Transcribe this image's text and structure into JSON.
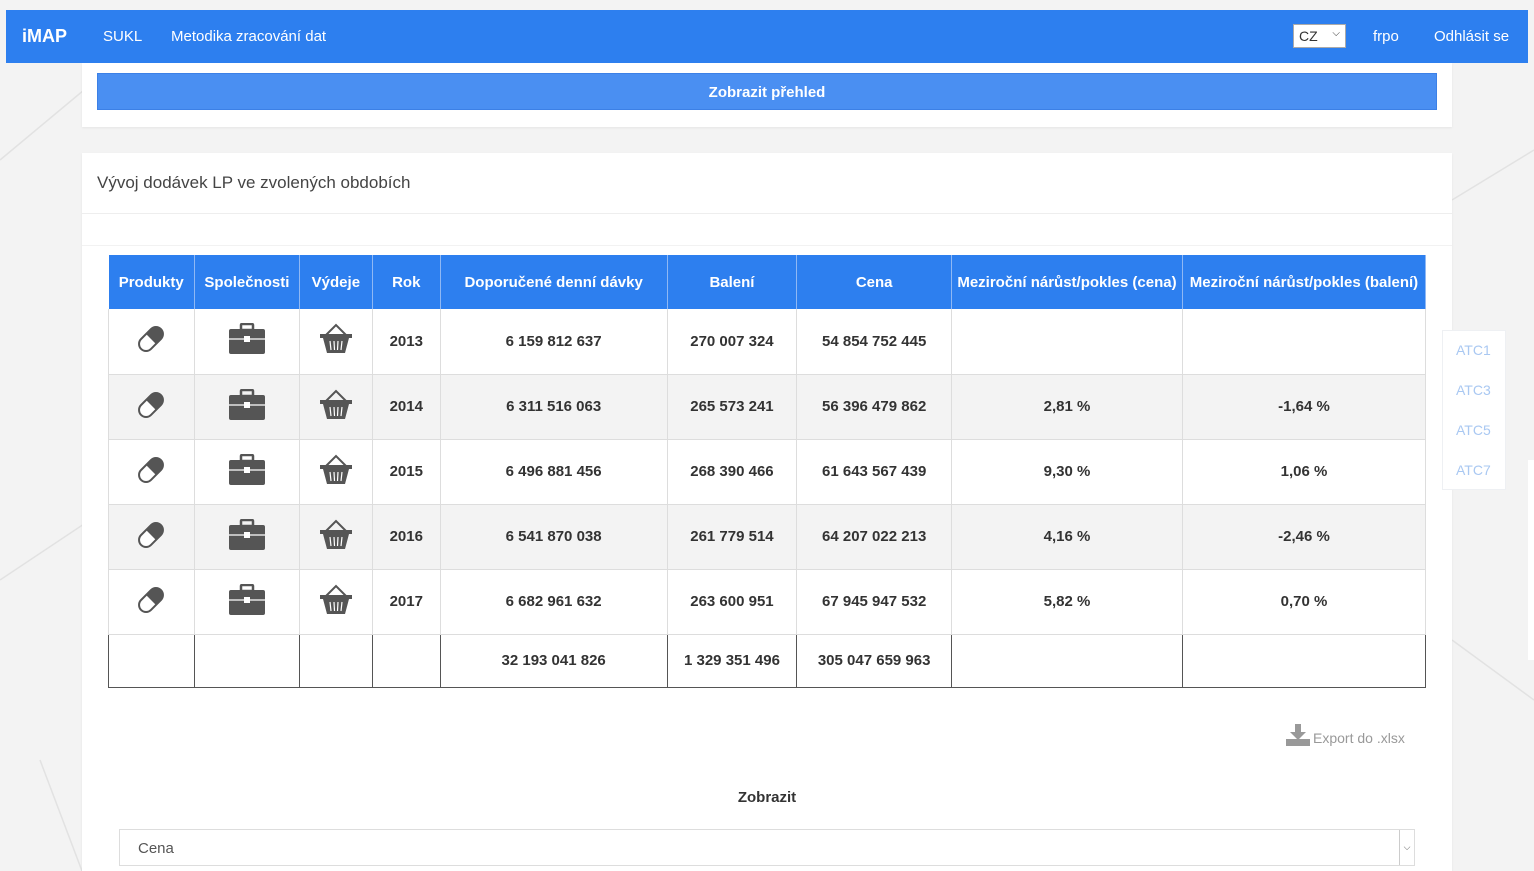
{
  "navbar": {
    "brand": "iMAP",
    "links": [
      "SUKL",
      "Metodika zracování dat"
    ],
    "language": "CZ",
    "user": "frpo",
    "logout": "Odhlásit se"
  },
  "top_card": {
    "button_label": "Zobrazit přehled"
  },
  "main": {
    "title": "Vývoj dodávek LP ve zvolených obdobích",
    "table": {
      "headers": [
        "Produkty",
        "Společnosti",
        "Výdeje",
        "Rok",
        "Doporučené denní dávky",
        "Balení",
        "Cena",
        "Meziroční nárůst/pokles (cena)",
        "Meziroční nárůst/pokles (balení)"
      ],
      "rows": [
        {
          "year": "2013",
          "ddd": "6 159 812 637",
          "baleni": "270 007 324",
          "cena": "54 854 752 445",
          "yoy_cena": "",
          "yoy_baleni": ""
        },
        {
          "year": "2014",
          "ddd": "6 311 516 063",
          "baleni": "265 573 241",
          "cena": "56 396 479 862",
          "yoy_cena": "2,81 %",
          "yoy_baleni": "-1,64 %"
        },
        {
          "year": "2015",
          "ddd": "6 496 881 456",
          "baleni": "268 390 466",
          "cena": "61 643 567 439",
          "yoy_cena": "9,30 %",
          "yoy_baleni": "1,06 %"
        },
        {
          "year": "2016",
          "ddd": "6 541 870 038",
          "baleni": "261 779 514",
          "cena": "64 207 022 213",
          "yoy_cena": "4,16 %",
          "yoy_baleni": "-2,46 %"
        },
        {
          "year": "2017",
          "ddd": "6 682 961 632",
          "baleni": "263 600 951",
          "cena": "67 945 947 532",
          "yoy_cena": "5,82 %",
          "yoy_baleni": "0,70 %"
        }
      ],
      "totals": {
        "ddd": "32 193 041 826",
        "baleni": "1 329 351 496",
        "cena": "305 047 659 963"
      }
    },
    "export_label": "Export do .xlsx",
    "zobrazit_label": "Zobrazit",
    "select_value": "Cena"
  },
  "side_tabs": [
    "ATC1",
    "ATC3",
    "ATC5",
    "ATC7"
  ],
  "icons": {
    "product": "pill-icon",
    "company": "briefcase-icon",
    "dispense": "basket-icon",
    "export": "download-icon"
  },
  "colors": {
    "primary": "#2d7fef",
    "button": "#4a8ff2",
    "side_tab_text": "#a9c8f2"
  }
}
